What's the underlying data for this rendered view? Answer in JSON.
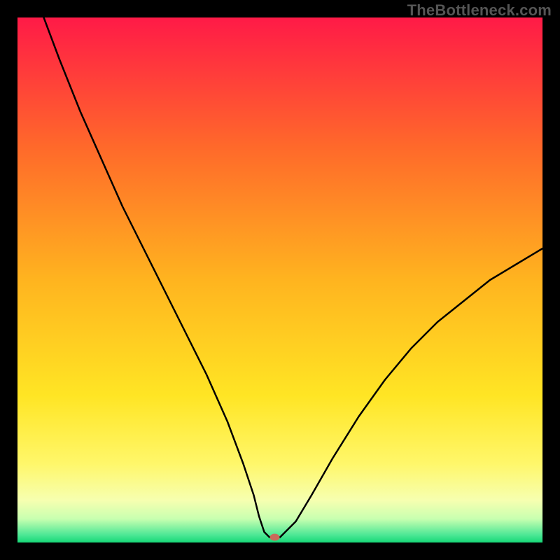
{
  "watermark": "TheBottleneck.com",
  "chart_data": {
    "type": "line",
    "title": "",
    "xlabel": "",
    "ylabel": "",
    "xlim": [
      0,
      100
    ],
    "ylim": [
      0,
      100
    ],
    "grid": false,
    "legend": false,
    "series": [
      {
        "name": "bottleneck-curve",
        "x": [
          5,
          8,
          12,
          16,
          20,
          24,
          28,
          32,
          36,
          40,
          43,
          45,
          46,
          47,
          48,
          49,
          50,
          53,
          56,
          60,
          65,
          70,
          75,
          80,
          85,
          90,
          95,
          100
        ],
        "y": [
          100,
          92,
          82,
          73,
          64,
          56,
          48,
          40,
          32,
          23,
          15,
          9,
          5,
          2,
          1,
          1,
          1,
          4,
          9,
          16,
          24,
          31,
          37,
          42,
          46,
          50,
          53,
          56
        ]
      }
    ],
    "marker": {
      "x": 49,
      "y": 1,
      "color": "#c96a5a"
    },
    "background_gradient": {
      "stops": [
        {
          "offset": 0.0,
          "color": "#ff1a47"
        },
        {
          "offset": 0.25,
          "color": "#ff6a2a"
        },
        {
          "offset": 0.5,
          "color": "#ffb41f"
        },
        {
          "offset": 0.72,
          "color": "#ffe524"
        },
        {
          "offset": 0.85,
          "color": "#fff76a"
        },
        {
          "offset": 0.92,
          "color": "#f6ffb0"
        },
        {
          "offset": 0.955,
          "color": "#c8ffb0"
        },
        {
          "offset": 0.985,
          "color": "#4fe896"
        },
        {
          "offset": 1.0,
          "color": "#17d877"
        }
      ]
    }
  }
}
